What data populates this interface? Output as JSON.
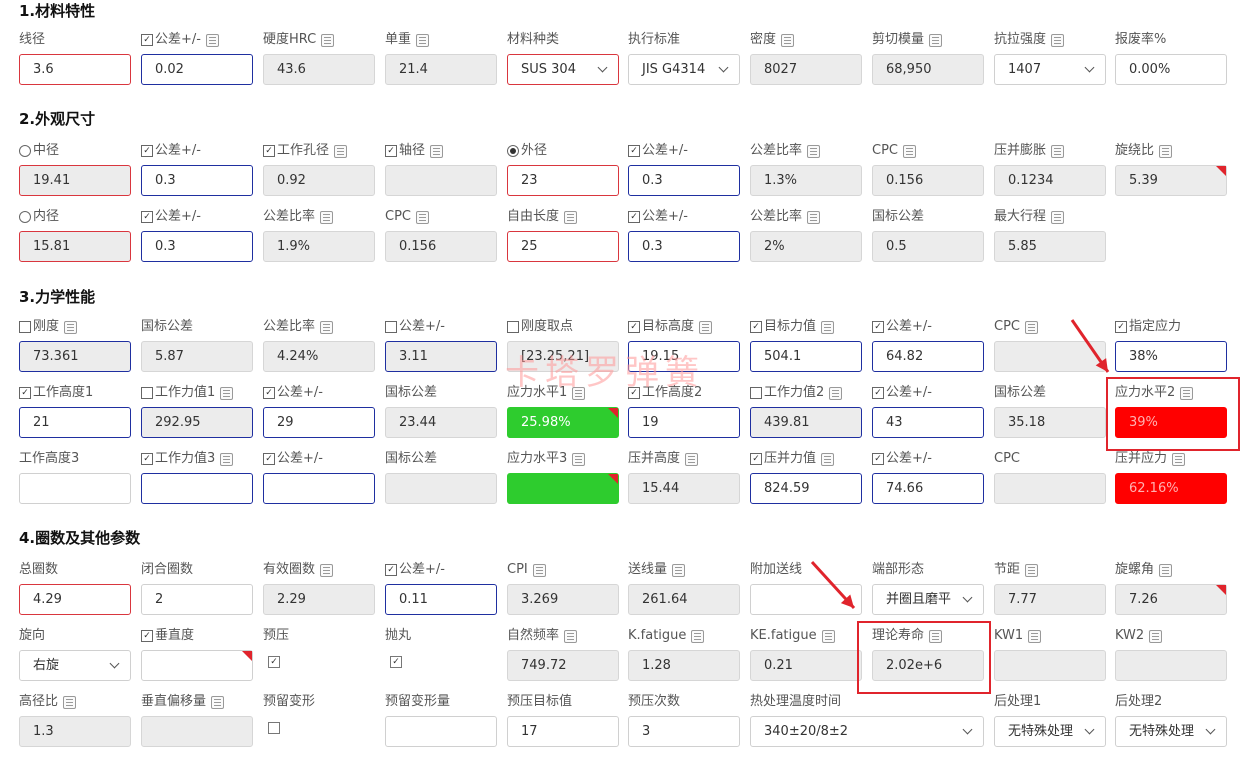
{
  "sections": [
    {
      "title": "1.材料特性"
    },
    {
      "title": "2.外观尺寸"
    },
    {
      "title": "3.力学性能"
    },
    {
      "title": "4.圈数及其他参数"
    }
  ],
  "fields": [
    {
      "label": "线径",
      "value": "3.6",
      "style": "red"
    },
    {
      "label": "公差+/-",
      "value": "0.02",
      "style": "blue",
      "prefix": "checked",
      "calc": true
    },
    {
      "label": "硬度HRC",
      "value": "43.6",
      "style": "gray",
      "calc": true
    },
    {
      "label": "单重",
      "value": "21.4",
      "style": "gray",
      "calc": true
    },
    {
      "label": "材料种类",
      "value": "SUS 304",
      "style": "red select"
    },
    {
      "label": "执行标准",
      "value": "JIS G4314",
      "style": "select"
    },
    {
      "label": "密度",
      "value": "8027",
      "style": "gray",
      "calc": true
    },
    {
      "label": "剪切模量",
      "value": "68,950",
      "style": "gray",
      "calc": true
    },
    {
      "label": "抗拉强度",
      "value": "1407",
      "style": "select",
      "calc": true
    },
    {
      "label": "报废率%",
      "value": "0.00%",
      "style": ""
    },
    {
      "label": "中径",
      "value": "19.41",
      "style": "gray red",
      "prefix": "radio"
    },
    {
      "label": "公差+/-",
      "value": "0.3",
      "style": "blue",
      "prefix": "checked"
    },
    {
      "label": "工作孔径",
      "value": "0.92",
      "style": "gray",
      "prefix": "checked",
      "calc": true
    },
    {
      "label": "轴径",
      "value": "",
      "style": "gray",
      "prefix": "checked",
      "calc": true
    },
    {
      "label": "外径",
      "value": "23",
      "style": "red",
      "prefix": "radio-on"
    },
    {
      "label": "公差+/-",
      "value": "0.3",
      "style": "blue",
      "prefix": "checked"
    },
    {
      "label": "公差比率",
      "value": "1.3%",
      "style": "gray",
      "calc": true
    },
    {
      "label": "CPC",
      "value": "0.156",
      "style": "gray",
      "calc": true
    },
    {
      "label": "压并膨胀",
      "value": "0.1234",
      "style": "gray",
      "calc": true
    },
    {
      "label": "旋绕比",
      "value": "5.39",
      "style": "gray tri",
      "calc": true
    },
    {
      "label": "内径",
      "value": "15.81",
      "style": "gray red",
      "prefix": "radio"
    },
    {
      "label": "公差+/-",
      "value": "0.3",
      "style": "blue",
      "prefix": "checked"
    },
    {
      "label": "公差比率",
      "value": "1.9%",
      "style": "gray",
      "calc": true
    },
    {
      "label": "CPC",
      "value": "0.156",
      "style": "gray",
      "calc": true
    },
    {
      "label": "自由长度",
      "value": "25",
      "style": "red",
      "calc": true
    },
    {
      "label": "公差+/-",
      "value": "0.3",
      "style": "blue",
      "prefix": "checked"
    },
    {
      "label": "公差比率",
      "value": "2%",
      "style": "gray",
      "calc": true
    },
    {
      "label": "国标公差",
      "value": "0.5",
      "style": "gray"
    },
    {
      "label": "最大行程",
      "value": "5.85",
      "style": "gray",
      "calc": true
    },
    {
      "label": "刚度",
      "value": "73.361",
      "style": "gray blue",
      "prefix": "unchecked",
      "calc": true
    },
    {
      "label": "国标公差",
      "value": "5.87",
      "style": "gray"
    },
    {
      "label": "公差比率",
      "value": "4.24%",
      "style": "gray",
      "calc": true
    },
    {
      "label": "公差+/-",
      "value": "3.11",
      "style": "gray blue",
      "prefix": "unchecked"
    },
    {
      "label": "刚度取点",
      "value": "[23.25,21]",
      "style": "gray",
      "prefix": "unchecked"
    },
    {
      "label": "目标高度",
      "value": "19.15",
      "style": "blue",
      "prefix": "checked",
      "calc": true
    },
    {
      "label": "目标力值",
      "value": "504.1",
      "style": "blue",
      "prefix": "checked",
      "calc": true
    },
    {
      "label": "公差+/-",
      "value": "64.82",
      "style": "blue",
      "prefix": "checked"
    },
    {
      "label": "CPC",
      "value": "",
      "style": "gray",
      "calc": true
    },
    {
      "label": "指定应力",
      "value": "38%",
      "style": "blue",
      "prefix": "checked"
    },
    {
      "label": "工作高度1",
      "value": "21",
      "style": "blue",
      "prefix": "checked"
    },
    {
      "label": "工作力值1",
      "value": "292.95",
      "style": "gray blue",
      "prefix": "unchecked",
      "calc": true
    },
    {
      "label": "公差+/-",
      "value": "29",
      "style": "blue",
      "prefix": "checked"
    },
    {
      "label": "国标公差",
      "value": "23.44",
      "style": "gray"
    },
    {
      "label": "应力水平1",
      "value": "25.98%",
      "style": "green tri",
      "calc": true
    },
    {
      "label": "工作高度2",
      "value": "19",
      "style": "blue",
      "prefix": "checked"
    },
    {
      "label": "工作力值2",
      "value": "439.81",
      "style": "gray blue",
      "prefix": "unchecked",
      "calc": true
    },
    {
      "label": "公差+/-",
      "value": "43",
      "style": "blue",
      "prefix": "checked"
    },
    {
      "label": "国标公差",
      "value": "35.18",
      "style": "gray"
    },
    {
      "label": "应力水平2",
      "value": "39%",
      "style": "fillred",
      "calc": true
    },
    {
      "label": "工作高度3",
      "value": "",
      "style": ""
    },
    {
      "label": "工作力值3",
      "value": "",
      "style": "blue",
      "prefix": "checked",
      "calc": true
    },
    {
      "label": "公差+/-",
      "value": "",
      "style": "blue",
      "prefix": "checked"
    },
    {
      "label": "国标公差",
      "value": "",
      "style": "gray"
    },
    {
      "label": "应力水平3",
      "value": "",
      "style": "green tri",
      "calc": true
    },
    {
      "label": "压并高度",
      "value": "15.44",
      "style": "gray",
      "calc": true
    },
    {
      "label": "压并力值",
      "value": "824.59",
      "style": "blue",
      "prefix": "checked",
      "calc": true
    },
    {
      "label": "公差+/-",
      "value": "74.66",
      "style": "blue",
      "prefix": "checked"
    },
    {
      "label": "CPC",
      "value": "",
      "style": "gray"
    },
    {
      "label": "压并应力",
      "value": "62.16%",
      "style": "fillred",
      "calc": true
    },
    {
      "label": "总圈数",
      "value": "4.29",
      "style": "red"
    },
    {
      "label": "闭合圈数",
      "value": "2",
      "style": ""
    },
    {
      "label": "有效圈数",
      "value": "2.29",
      "style": "gray",
      "calc": true
    },
    {
      "label": "公差+/-",
      "value": "0.11",
      "style": "blue",
      "prefix": "checked"
    },
    {
      "label": "CPI",
      "value": "3.269",
      "style": "gray",
      "calc": true
    },
    {
      "label": "送线量",
      "value": "261.64",
      "style": "gray",
      "calc": true
    },
    {
      "label": "附加送线",
      "value": "",
      "style": ""
    },
    {
      "label": "端部形态",
      "value": "并圈且磨平",
      "style": "select"
    },
    {
      "label": "节距",
      "value": "7.77",
      "style": "gray",
      "calc": true
    },
    {
      "label": "旋螺角",
      "value": "7.26",
      "style": "gray tri",
      "calc": true
    },
    {
      "label": "旋向",
      "value": "右旋",
      "style": "select"
    },
    {
      "label": "垂直度",
      "value": "",
      "style": "tri",
      "prefix": "checked"
    },
    {
      "label": "预压",
      "value": "",
      "style": "checkbox-checked"
    },
    {
      "label": "抛丸",
      "value": "",
      "style": "checkbox-checked"
    },
    {
      "label": "自然频率",
      "value": "749.72",
      "style": "gray",
      "calc": true
    },
    {
      "label": "K.fatigue",
      "value": "1.28",
      "style": "gray",
      "calc": true
    },
    {
      "label": "KE.fatigue",
      "value": "0.21",
      "style": "gray",
      "calc": true
    },
    {
      "label": "理论寿命",
      "value": "2.02e+6",
      "style": "gray",
      "calc": true
    },
    {
      "label": "KW1",
      "value": "",
      "style": "gray",
      "calc": true
    },
    {
      "label": "KW2",
      "value": "",
      "style": "gray",
      "calc": true
    },
    {
      "label": "高径比",
      "value": "1.3",
      "style": "gray",
      "calc": true
    },
    {
      "label": "垂直偏移量",
      "value": "",
      "style": "gray",
      "calc": true
    },
    {
      "label": "预留变形",
      "value": "",
      "style": "checkbox"
    },
    {
      "label": "预留变形量",
      "value": "",
      "style": ""
    },
    {
      "label": "预压目标值",
      "value": "17",
      "style": ""
    },
    {
      "label": "预压次数",
      "value": "3",
      "style": ""
    },
    {
      "label": "热处理温度时间",
      "value": "340±20/8±2",
      "style": "select wide"
    },
    {
      "label": "后处理1",
      "value": "无特殊处理",
      "style": "select"
    },
    {
      "label": "后处理2",
      "value": "无特殊处理",
      "style": "select"
    }
  ],
  "watermark": "卡塔罗弹簧",
  "colors": {
    "accent_red": "#e0242c",
    "blue_border": "#1f2fa0",
    "green": "#2ecc2e",
    "stress_red": "#ff0000"
  }
}
